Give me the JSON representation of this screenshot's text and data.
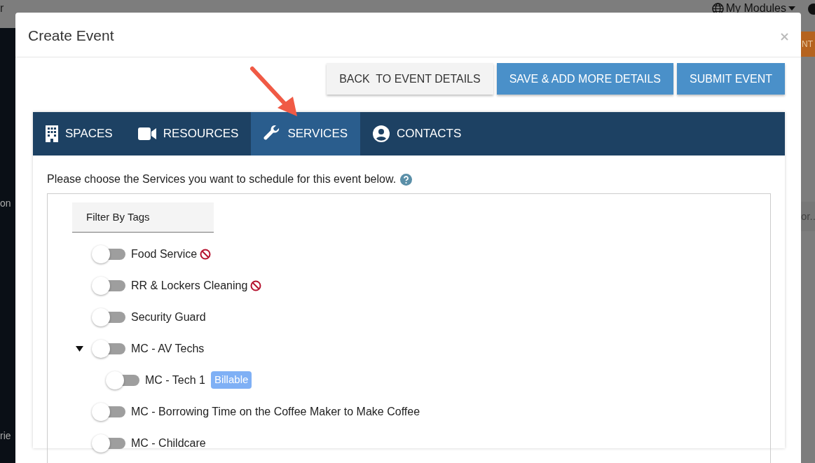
{
  "background_page": {
    "top_left_text": "r",
    "menu": "My Modules",
    "left_texts": [
      "on",
      "rie"
    ],
    "right_button": "NT",
    "right_field_text": "or.."
  },
  "modal": {
    "title": "Create Event"
  },
  "actions": [
    {
      "label": "BACK  TO EVENT DETAILS",
      "kind": "secondary"
    },
    {
      "label": "SAVE & ADD MORE DETAILS",
      "kind": "primary"
    },
    {
      "label": "SUBMIT EVENT",
      "kind": "primary"
    }
  ],
  "tabs": [
    {
      "label": "SPACES",
      "kind": "building",
      "selected": false
    },
    {
      "label": "RESOURCES",
      "kind": "camera",
      "selected": false
    },
    {
      "label": "SERVICES",
      "kind": "wrench",
      "selected": true
    },
    {
      "label": "CONTACTS",
      "kind": "person",
      "selected": false
    }
  ],
  "instructions": "Please choose the Services you want to schedule for this event below.",
  "filter_button": "Filter By Tags",
  "services": [
    {
      "name": "Food Service",
      "on": false,
      "blocked": true
    },
    {
      "name": "RR & Lockers Cleaning",
      "on": false,
      "blocked": true
    },
    {
      "name": "Security Guard",
      "on": false,
      "blocked": false
    },
    {
      "name": "MC - AV Techs",
      "on": false,
      "blocked": false,
      "expanded": true,
      "children": [
        {
          "name": "MC - Tech 1",
          "on": false,
          "blocked": false,
          "tag": "Billable"
        }
      ]
    },
    {
      "name": "MC - Borrowing Time on the Coffee Maker to Make Coffee",
      "on": false,
      "blocked": false
    },
    {
      "name": "MC - Childcare",
      "on": false,
      "blocked": false
    }
  ]
}
